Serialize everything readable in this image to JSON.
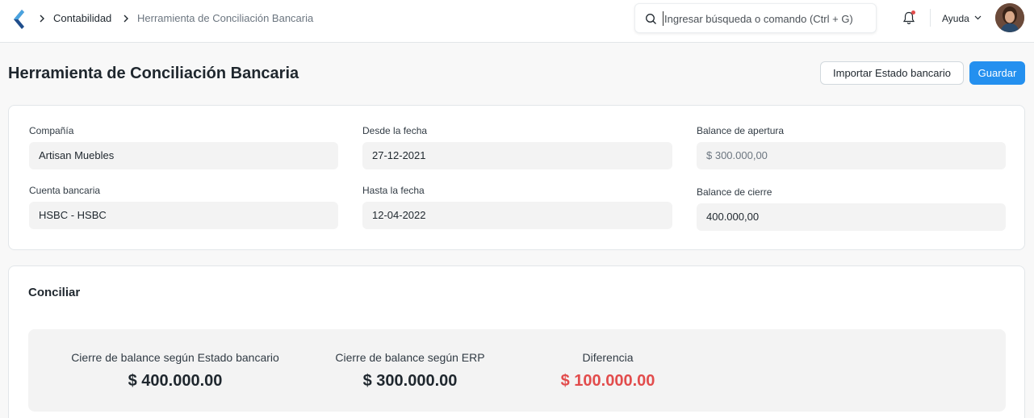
{
  "navbar": {
    "breadcrumbs": [
      "Contabilidad",
      "Herramienta de Conciliación Bancaria"
    ],
    "search_placeholder": "Ingresar búsqueda o comando (Ctrl + G)",
    "help_label": "Ayuda"
  },
  "page": {
    "title": "Herramienta de Conciliación Bancaria",
    "import_button": "Importar Estado bancario",
    "save_button": "Guardar"
  },
  "form": {
    "company": {
      "label": "Compañía",
      "value": "Artisan Muebles"
    },
    "bank_account": {
      "label": "Cuenta bancaria",
      "value": "HSBC - HSBC"
    },
    "from_date": {
      "label": "Desde la fecha",
      "value": "27-12-2021"
    },
    "to_date": {
      "label": "Hasta la fecha",
      "value": "12-04-2022"
    },
    "opening_balance": {
      "label": "Balance de apertura",
      "value": "$ 300.000,00"
    },
    "closing_balance": {
      "label": "Balance de cierre",
      "value": "400.000,00"
    }
  },
  "reconcile": {
    "title": "Conciliar",
    "summary": [
      {
        "label": "Cierre de balance según Estado bancario",
        "value": "$ 400.000.00"
      },
      {
        "label": "Cierre de balance según ERP",
        "value": "$ 300.000.00"
      },
      {
        "label": "Diferencia",
        "value": "$ 100.000.00"
      }
    ]
  },
  "colors": {
    "primary": "#2490ef",
    "negative": "#e24c4c",
    "logo": "#1f4e8c"
  }
}
